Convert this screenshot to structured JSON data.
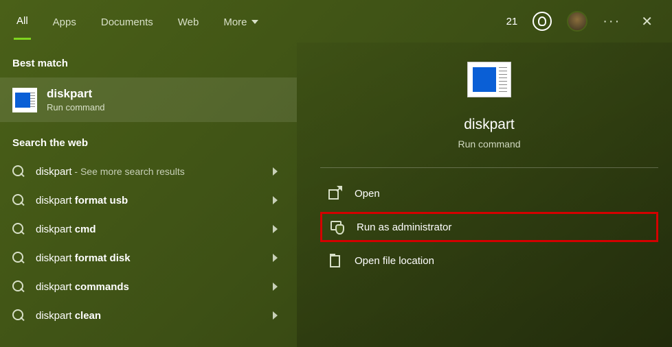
{
  "topbar": {
    "tabs": {
      "all": "All",
      "apps": "Apps",
      "documents": "Documents",
      "web": "Web",
      "more": "More"
    },
    "reward_count": "21"
  },
  "left": {
    "best_match_label": "Best match",
    "best_match": {
      "title": "diskpart",
      "subtitle": "Run command"
    },
    "search_web_label": "Search the web",
    "web_items": [
      {
        "prefix": "diskpart",
        "suffix": "",
        "extra": " - See more search results"
      },
      {
        "prefix": "diskpart ",
        "suffix": "format usb",
        "extra": ""
      },
      {
        "prefix": "diskpart ",
        "suffix": "cmd",
        "extra": ""
      },
      {
        "prefix": "diskpart ",
        "suffix": "format disk",
        "extra": ""
      },
      {
        "prefix": "diskpart ",
        "suffix": "commands",
        "extra": ""
      },
      {
        "prefix": "diskpart ",
        "suffix": "clean",
        "extra": ""
      }
    ]
  },
  "right": {
    "title": "diskpart",
    "subtitle": "Run command",
    "actions": {
      "open": "Open",
      "admin": "Run as administrator",
      "location": "Open file location"
    }
  }
}
